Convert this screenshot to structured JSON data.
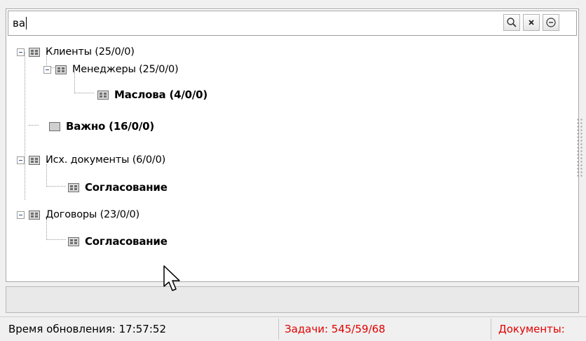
{
  "search": {
    "value": "ва",
    "buttons": [
      {
        "name": "search-button",
        "icon": "magnifier-icon"
      },
      {
        "name": "clear-button",
        "icon": "close-icon"
      },
      {
        "name": "options-button",
        "icon": "minus-circle-icon"
      }
    ]
  },
  "tree": {
    "nodes": [
      {
        "label": "Клиенты (25/0/0)",
        "bold": false,
        "expanded": true,
        "icon": "list-folder-icon"
      },
      {
        "label": "Менеджеры (25/0/0)",
        "bold": false,
        "expanded": true,
        "icon": "list-folder-icon"
      },
      {
        "label": "Маслова (4/0/0)",
        "bold": true,
        "icon": "list-folder-icon"
      },
      {
        "label": "Важно (16/0/0)",
        "bold": true,
        "icon": "folder-icon"
      },
      {
        "label": "Исх. документы (6/0/0)",
        "bold": false,
        "expanded": true,
        "icon": "list-folder-icon"
      },
      {
        "label": "Согласование",
        "bold": true,
        "icon": "list-folder-icon"
      },
      {
        "label": "Договоры (23/0/0)",
        "bold": false,
        "expanded": true,
        "icon": "list-folder-icon"
      },
      {
        "label": "Согласование",
        "bold": true,
        "icon": "list-folder-icon"
      }
    ]
  },
  "status": {
    "update_time": "Время обновления: 17:57:52",
    "tasks": "Задачи: 545/59/68",
    "documents": "Документы:",
    "alert_color": "#e00000"
  }
}
